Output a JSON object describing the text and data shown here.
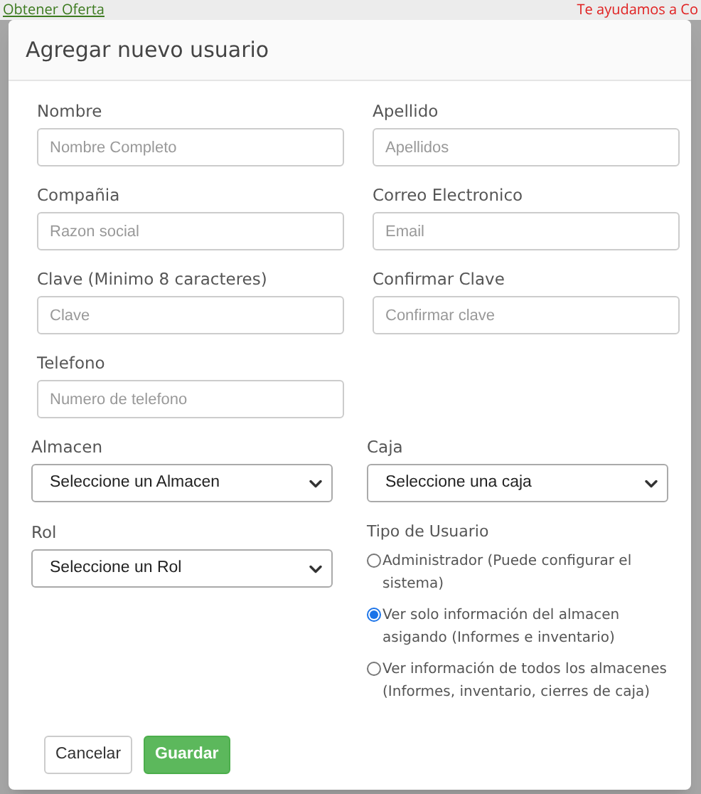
{
  "background": {
    "offer_link": "Obtener Oferta",
    "help_text": "Te ayudamos a Co"
  },
  "modal": {
    "title": "Agregar nuevo usuario",
    "fields": [
      {
        "label": "Nombre",
        "placeholder": "Nombre Completo"
      },
      {
        "label": "Apellido",
        "placeholder": "Apellidos"
      },
      {
        "label": "Compañia",
        "placeholder": "Razon social"
      },
      {
        "label": "Correo Electronico",
        "placeholder": "Email"
      },
      {
        "label": "Clave (Minimo 8 caracteres)",
        "placeholder": "Clave"
      },
      {
        "label": "Confirmar Clave",
        "placeholder": "Confirmar clave"
      },
      {
        "label": "Telefono",
        "placeholder": "Numero de telefono"
      }
    ],
    "selects": [
      {
        "label": "Almacen",
        "value": "Seleccione un Almacen"
      },
      {
        "label": "Caja",
        "value": "Seleccione una caja"
      },
      {
        "label": "Rol",
        "value": "Seleccione un Rol"
      }
    ],
    "user_type": {
      "label": "Tipo de Usuario",
      "options": [
        {
          "label": "Administrador (Puede configurar el sistema)",
          "selected": false
        },
        {
          "label": "Ver solo información del almacen asigando (Informes e inventario)",
          "selected": true
        },
        {
          "label": "Ver información de todos los almacenes (Informes, inventario, cierres de caja)",
          "selected": false
        }
      ]
    },
    "buttons": [
      {
        "label": "Cancelar",
        "kind": "secondary"
      },
      {
        "label": "Guardar",
        "kind": "primary"
      }
    ]
  }
}
